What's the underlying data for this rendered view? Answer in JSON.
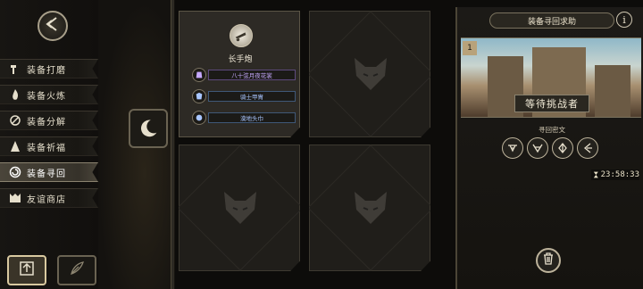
{
  "sidebar": {
    "back_icon": "back-arrow-icon",
    "items": [
      {
        "label": "装备打磨",
        "icon": "hammer-icon"
      },
      {
        "label": "装备火炼",
        "icon": "flame-icon"
      },
      {
        "label": "装备分解",
        "icon": "disassemble-icon"
      },
      {
        "label": "装备祈福",
        "icon": "pray-icon"
      },
      {
        "label": "装备寻回",
        "icon": "retrieve-icon",
        "active": true
      },
      {
        "label": "友谊商店",
        "icon": "shop-icon"
      }
    ],
    "bottom_tabs": [
      {
        "icon": "upload-icon",
        "active": true
      },
      {
        "icon": "feather-icon"
      },
      {
        "icon": "list-icon"
      }
    ]
  },
  "equipment_grid": {
    "slot1": {
      "name": "长手炮",
      "parts": [
        {
          "label": "八十弦月夜花裳",
          "rarity": "purple"
        },
        {
          "label": "骑士甲胄",
          "rarity": "blue"
        },
        {
          "label": "漠地头巾",
          "rarity": "blue"
        }
      ]
    }
  },
  "right_panel": {
    "title": "装备寻回求助",
    "info_label": "i",
    "slot_number": "1",
    "status": "等待挑战者",
    "cipher_label": "寻回密文",
    "ciphers": [
      "cipher-a-icon",
      "cipher-b-icon",
      "cipher-c-icon",
      "cipher-d-icon"
    ],
    "timer": "23:58:33"
  },
  "colors": {
    "accent": "#d9c9a0",
    "purple": "#c6a9ff",
    "blue": "#a9c6ff"
  }
}
